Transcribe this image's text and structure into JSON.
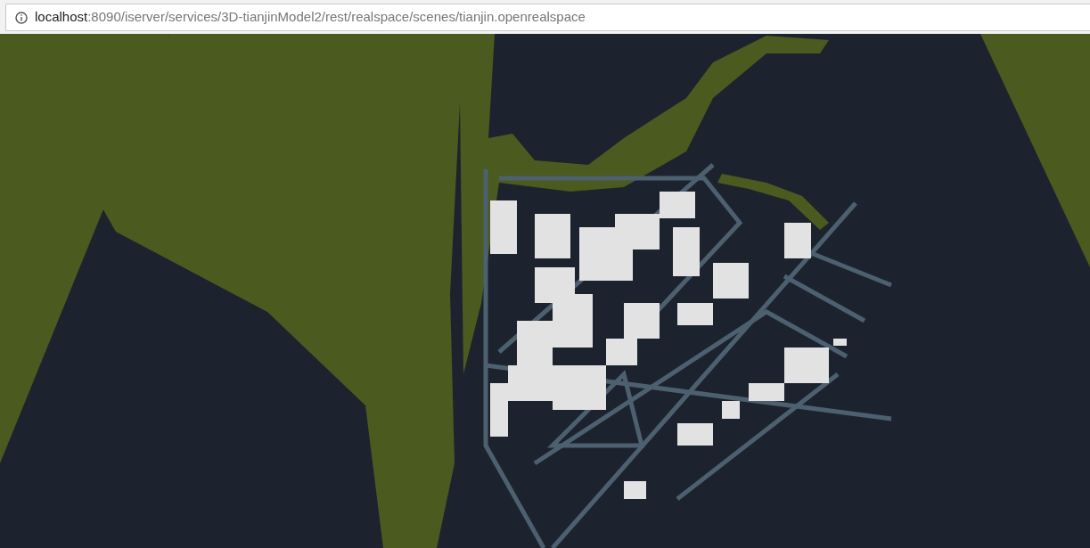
{
  "address_bar": {
    "host": "localhost",
    "path": ":8090/iserver/services/3D-tianjinModel2/rest/realspace/scenes/tianjin.openrealspace"
  }
}
